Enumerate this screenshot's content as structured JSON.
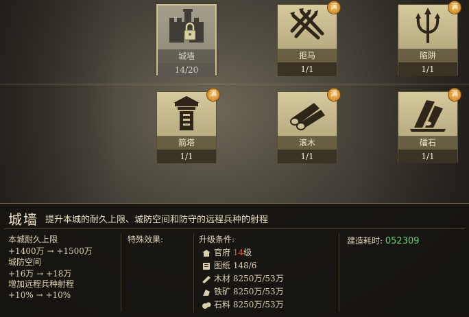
{
  "buildings": [
    {
      "name": "城墙",
      "count": "14/20",
      "icon": "wall-lock-icon",
      "maxed": false,
      "selected": true
    },
    {
      "name": "拒马",
      "count": "1/1",
      "icon": "spikes-icon",
      "maxed": true,
      "selected": false
    },
    {
      "name": "陷阱",
      "count": "1/1",
      "icon": "trident-icon",
      "maxed": true,
      "selected": false
    },
    {
      "name": "箭塔",
      "count": "1/1",
      "icon": "tower-icon",
      "maxed": true,
      "selected": false
    },
    {
      "name": "滚木",
      "count": "1/1",
      "icon": "logs-icon",
      "maxed": true,
      "selected": false
    },
    {
      "name": "礌石",
      "count": "1/1",
      "icon": "rocks-icon",
      "maxed": true,
      "selected": false
    }
  ],
  "badge_label": "满",
  "detail": {
    "title": "城墙",
    "description": "提升本城的耐久上限、城防空间和防守的远程兵种的射程",
    "stats": [
      {
        "label": "本城耐久上限",
        "from": "+1400万",
        "to": "+1500万"
      },
      {
        "label": "城防空间",
        "from": "+16万",
        "to": "+18万"
      },
      {
        "label": "增加远程兵种射程",
        "from": "+10%",
        "to": "+10%"
      }
    ],
    "arrow": "→",
    "special_label": "特殊效果:",
    "requirements_label": "升级条件:",
    "requirements": [
      {
        "icon": "government-icon",
        "name": "官府",
        "value": "14",
        "suffix": "级",
        "highlight": "#e05a4a"
      },
      {
        "icon": "blueprint-icon",
        "name": "图纸",
        "value": "148/6",
        "suffix": ""
      },
      {
        "icon": "wood-icon",
        "name": "木材",
        "value": "8250万/53万",
        "suffix": ""
      },
      {
        "icon": "iron-ore-icon",
        "name": "铁矿",
        "value": "8250万/53万",
        "suffix": ""
      },
      {
        "icon": "stone-icon",
        "name": "石料",
        "value": "8250万/53万",
        "suffix": ""
      }
    ],
    "build_time_label": "建造耗时:",
    "build_time": "052309"
  },
  "colors": {
    "accent_green": "#6ccf7a",
    "warning_red": "#e05a4a",
    "badge_orange": "#d9952f"
  }
}
